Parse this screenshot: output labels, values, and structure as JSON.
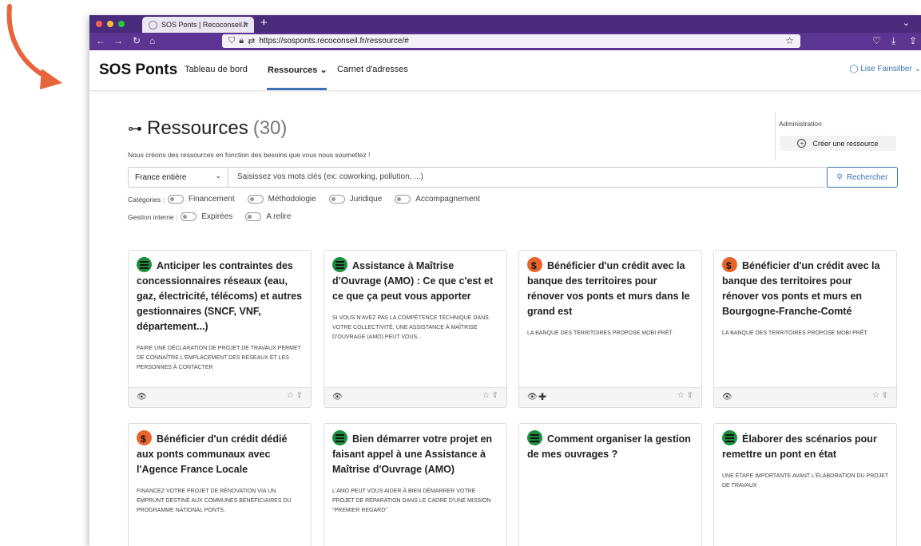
{
  "browser": {
    "tab_title": "SOS Ponts | Recoconseil.fr",
    "url": "https://sosponts.recoconseil.fr/ressource/#"
  },
  "app": {
    "brand": "SOS Ponts",
    "nav": [
      "Tableau de bord",
      "Ressources",
      "Carnet d'adresses"
    ],
    "user": "Lise Fainsilber"
  },
  "page": {
    "title": "Ressources",
    "count": "(30)",
    "subtitle": "Nous créons des ressources en fonction des besoins que vous nous soumettez !",
    "admin_label": "Administration",
    "create_button": "Créer une ressource"
  },
  "search": {
    "scope": "France entière",
    "placeholder": "Saisissez vos mots clés (ex: coworking, pollution, ...)",
    "button": "Rechercher"
  },
  "filters": {
    "categories_label": "Catégories :",
    "categories": [
      "Financement",
      "Méthodologie",
      "Juridique",
      "Accompagnement"
    ],
    "internal_label": "Gestion interne :",
    "internal": [
      "Expirées",
      "A relire"
    ]
  },
  "colors": {
    "accent": "#3b73b9",
    "browser": "#5b3591",
    "green_icon": "#1e8e3e",
    "orange_icon": "#e8642c"
  },
  "cards": [
    {
      "icon": "green",
      "title": "Anticiper les contraintes des concessionnaires réseaux (eau, gaz, électricité, télécoms) et autres gestionnaires (SNCF, VNF, département...)",
      "desc": "Faire une déclaration de projet de travaux permet de connaître l'emplacement des réseaux et les personnes à contacter",
      "footer_extra": ""
    },
    {
      "icon": "green",
      "title": "Assistance à Maîtrise d'Ouvrage (AMO) : Ce que c'est et ce que ça peut vous apporter",
      "desc": "Si vous n'avez pas la compétence technique dans votre collectivité, une Assistance à Maîtrise d'Ouvrage (AMO) peut vous...",
      "footer_extra": ""
    },
    {
      "icon": "orange",
      "title": "Bénéficier d'un crédit avec la banque des territoires pour rénover vos ponts et murs dans le grand est",
      "desc": "La banque des territoires propose Mobi Prêt",
      "footer_extra": "✚"
    },
    {
      "icon": "orange",
      "title": "Bénéficier d'un crédit avec la banque des territoires pour rénover vos ponts et murs en Bourgogne-Franche-Comté",
      "desc": "La banque des territoires propose Mobi Prêt",
      "footer_extra": ""
    },
    {
      "icon": "orange",
      "title": "Bénéficier d'un crédit dédié aux ponts communaux avec l'Agence France Locale",
      "desc": "Financez votre projet de rénovation via un emprunt destiné aux communes bénéficiaires du programme national ponts.",
      "footer_extra": ""
    },
    {
      "icon": "green",
      "title": "Bien démarrer votre projet en faisant appel à une Assistance à Maîtrise d'Ouvrage (AMO)",
      "desc": "L'AMO peut vous aider à bien démarrer votre projet de réparation dans le cadre d'une mission \"premier regard\"",
      "footer_extra": ""
    },
    {
      "icon": "green",
      "title": "Comment organiser la gestion de mes ouvrages ?",
      "desc": "",
      "footer_extra": ""
    },
    {
      "icon": "green",
      "title": "Élaborer des scénarios pour remettre un pont en état",
      "desc": "Une étape importante avant l'élaboration du projet de travaux",
      "footer_extra": ""
    }
  ]
}
